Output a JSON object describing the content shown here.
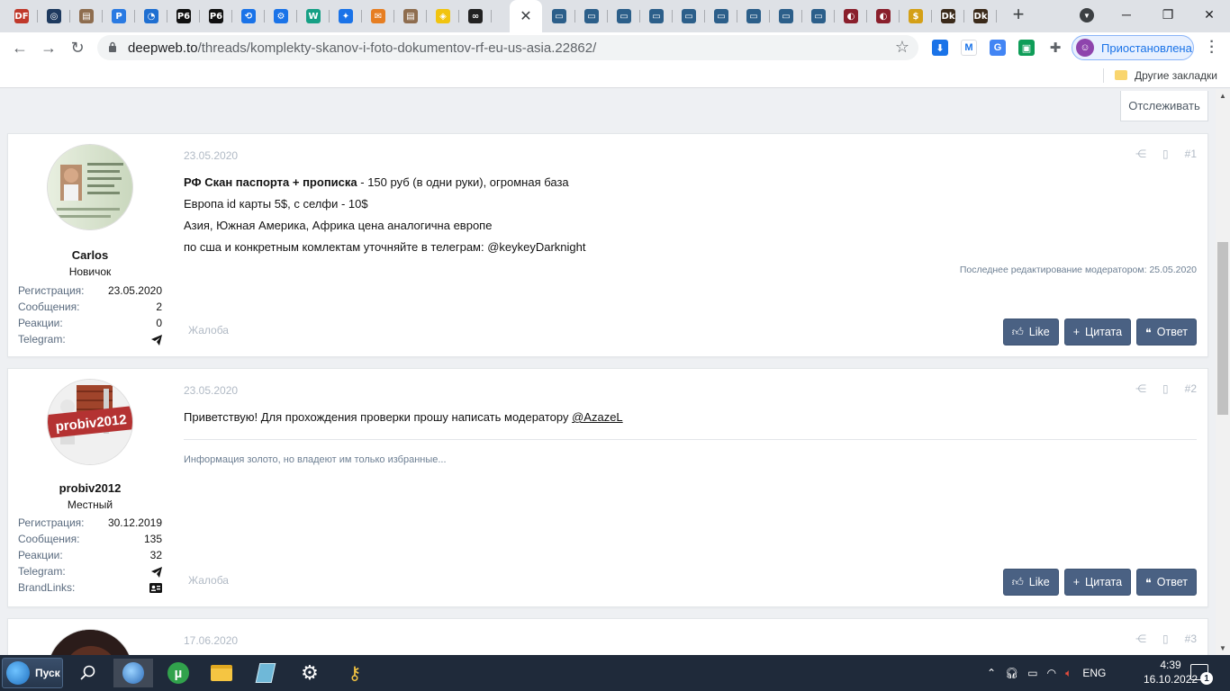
{
  "browser": {
    "tab_favicons": [
      {
        "name": "tab-favicon-1",
        "label": "DF",
        "color": "#c0392b"
      },
      {
        "name": "tab-favicon-2",
        "label": "◎",
        "color": "#1e3a5f"
      },
      {
        "name": "tab-favicon-3",
        "label": "▤",
        "color": "#8e6d4f"
      },
      {
        "name": "tab-favicon-4",
        "label": "P",
        "color": "#2a7ae2"
      },
      {
        "name": "tab-favicon-5",
        "label": "◔",
        "color": "#1f6fd1"
      },
      {
        "name": "tab-favicon-6",
        "label": "P6",
        "color": "#111111"
      },
      {
        "name": "tab-favicon-7",
        "label": "P6",
        "color": "#111111"
      },
      {
        "name": "tab-favicon-8",
        "label": "⟲",
        "color": "#1a73e8"
      },
      {
        "name": "tab-favicon-9",
        "label": "⚙",
        "color": "#1a73e8"
      },
      {
        "name": "tab-favicon-10",
        "label": "W",
        "color": "#16a085"
      },
      {
        "name": "tab-favicon-11",
        "label": "✦",
        "color": "#1a73e8"
      },
      {
        "name": "tab-favicon-12",
        "label": "✉",
        "color": "#e67e22"
      },
      {
        "name": "tab-favicon-13",
        "label": "▤",
        "color": "#8e6d4f"
      },
      {
        "name": "tab-favicon-14",
        "label": "◈",
        "color": "#f1c40f"
      },
      {
        "name": "tab-favicon-15",
        "label": "∞",
        "color": "#222222"
      }
    ],
    "tab_favicons_right": [
      {
        "name": "tab-favicon-16",
        "label": "▭",
        "color": "#2c5f8a"
      },
      {
        "name": "tab-favicon-17",
        "label": "▭",
        "color": "#2c5f8a"
      },
      {
        "name": "tab-favicon-18",
        "label": "▭",
        "color": "#2c5f8a"
      },
      {
        "name": "tab-favicon-19",
        "label": "▭",
        "color": "#2c5f8a"
      },
      {
        "name": "tab-favicon-20",
        "label": "▭",
        "color": "#2c5f8a"
      },
      {
        "name": "tab-favicon-21",
        "label": "▭",
        "color": "#2c5f8a"
      },
      {
        "name": "tab-favicon-22",
        "label": "▭",
        "color": "#2c5f8a"
      },
      {
        "name": "tab-favicon-23",
        "label": "▭",
        "color": "#2c5f8a"
      },
      {
        "name": "tab-favicon-24",
        "label": "▭",
        "color": "#2c5f8a"
      },
      {
        "name": "tab-favicon-25",
        "label": "◐",
        "color": "#8a1f2c"
      },
      {
        "name": "tab-favicon-26",
        "label": "◐",
        "color": "#8a1f2c"
      },
      {
        "name": "tab-favicon-27",
        "label": "$",
        "color": "#d4a017"
      },
      {
        "name": "tab-favicon-28",
        "label": "Dk",
        "color": "#3b2a1a"
      },
      {
        "name": "tab-favicon-29",
        "label": "Dk",
        "color": "#3b2a1a"
      }
    ],
    "url_host": "deepweb.to",
    "url_path": "/threads/komplekty-skanov-i-foto-dokumentov-rf-eu-us-asia.22862/",
    "profile_label": "Приостановлена",
    "bookmarks_folder": "Другие закладки"
  },
  "page": {
    "follow_label": "Отслеживать",
    "posts": [
      {
        "author": "Carlos",
        "user_title": "Новичок",
        "stats": [
          {
            "key": "Регистрация:",
            "value": "23.05.2020"
          },
          {
            "key": "Сообщения:",
            "value": "2"
          },
          {
            "key": "Реакции:",
            "value": "0"
          },
          {
            "key": "Telegram:",
            "value": ""
          }
        ],
        "date": "23.05.2020",
        "number": "#1",
        "line1_bold": "РФ Скан паспорта + прописка",
        "line1_rest": " - 150 руб (в одни руки), огромная база",
        "line2": "Европа id карты 5$, с селфи - 10$",
        "line3": "Азия, Южная Америка, Африка цена аналогична европе",
        "line4": "по сша и конкретным комлектам уточняйте в телеграм: @keykeyDarknight",
        "edit_note": "Последнее редактирование модератором: 25.05.2020",
        "report": "Жалоба"
      },
      {
        "author": "probiv2012",
        "user_title": "Местный",
        "avatar_text": "probiv2012",
        "stats": [
          {
            "key": "Регистрация:",
            "value": "30.12.2019"
          },
          {
            "key": "Сообщения:",
            "value": "135"
          },
          {
            "key": "Реакции:",
            "value": "32"
          },
          {
            "key": "Telegram:",
            "value": ""
          },
          {
            "key": "BrandLinks:",
            "value": ""
          }
        ],
        "date": "23.05.2020",
        "number": "#2",
        "body_text": "Приветствую! Для прохождения проверки прошу написать модератору ",
        "mention": "@AzazeL",
        "signature": "Информация золото, но владеют им только избранные...",
        "report": "Жалоба"
      },
      {
        "date": "17.06.2020",
        "number": "#3"
      }
    ],
    "buttons": {
      "like": "Like",
      "quote": "Цитата",
      "reply": "Ответ"
    }
  },
  "taskbar": {
    "start_label": "Пуск",
    "lang": "ENG",
    "time": "4:39",
    "date": "16.10.2022",
    "notifications": "1"
  },
  "colors": {
    "accent_button": "#4a6183",
    "muted_text": "#b1bac5",
    "link_blue": "#1a73e8"
  }
}
